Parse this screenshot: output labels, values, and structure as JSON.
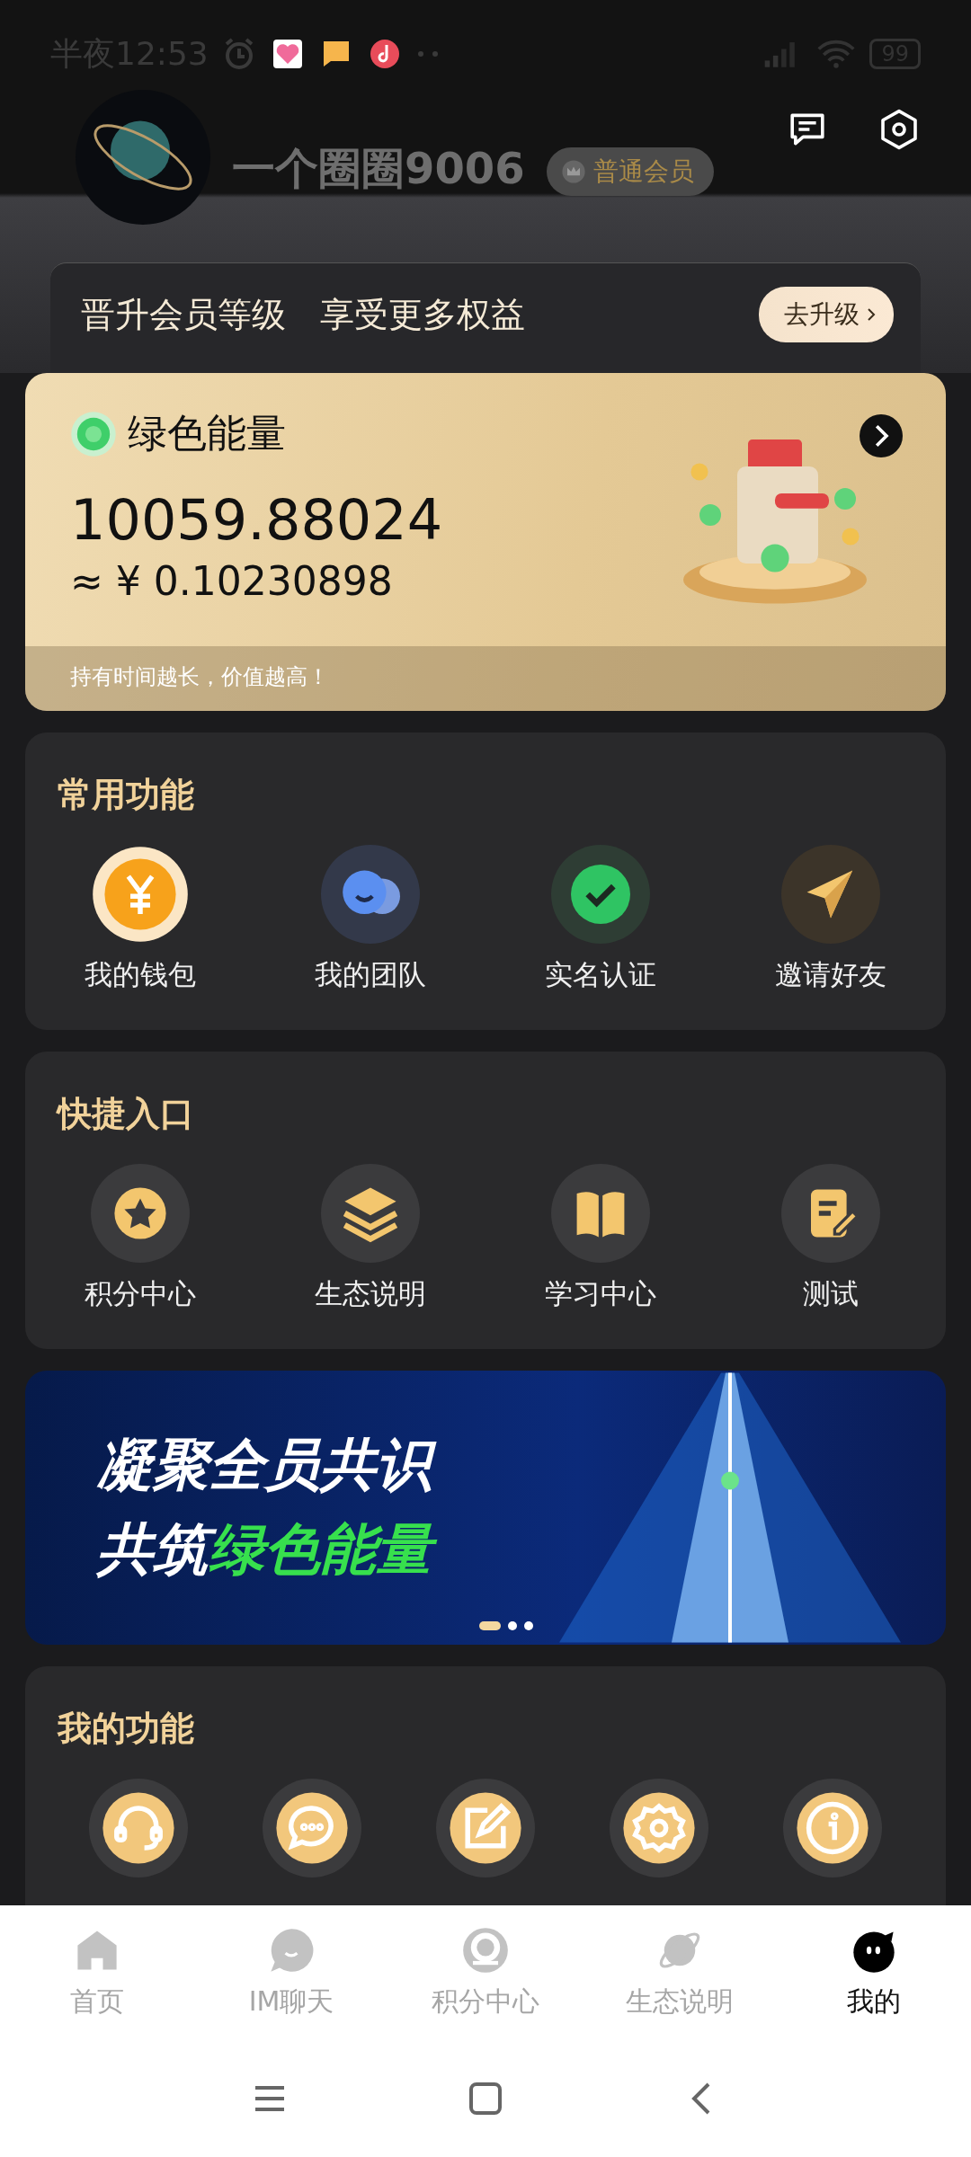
{
  "status_bar": {
    "time": "半夜12:53",
    "battery": "99"
  },
  "profile": {
    "name": "一个圈圈9006",
    "badge": "普通会员"
  },
  "upgrade": {
    "text_1": "晋升会员等级",
    "text_2": "享受更多权益",
    "button": "去升级"
  },
  "energy": {
    "title": "绿色能量",
    "amount": "10059.88024",
    "value": "≈ ¥ 0.10230898",
    "note": "持有时间越长，价值越高！"
  },
  "common": {
    "title": "常用功能",
    "items": [
      {
        "label": "我的钱包",
        "kind": "wallet"
      },
      {
        "label": "我的团队",
        "kind": "team"
      },
      {
        "label": "实名认证",
        "kind": "verify"
      },
      {
        "label": "邀请好友",
        "kind": "invite"
      }
    ]
  },
  "quick": {
    "title": "快捷入口",
    "items": [
      {
        "label": "积分中心",
        "kind": "star"
      },
      {
        "label": "生态说明",
        "kind": "layers"
      },
      {
        "label": "学习中心",
        "kind": "book"
      },
      {
        "label": "测试",
        "kind": "note"
      }
    ]
  },
  "banner": {
    "line_1": "凝聚全员共识",
    "line_2": "共筑",
    "line_2_highlight": "绿色能量",
    "dots": [
      {
        "selected": true
      },
      {
        "selected": false
      },
      {
        "selected": false
      }
    ]
  },
  "my_functions": {
    "title": "我的功能",
    "items": [
      {
        "kind": "headset"
      },
      {
        "kind": "chat"
      },
      {
        "kind": "edit"
      },
      {
        "kind": "gear"
      },
      {
        "kind": "info"
      }
    ]
  },
  "tabs": [
    {
      "label": "首页",
      "kind": "home",
      "selected": false
    },
    {
      "label": "IM聊天",
      "kind": "chat",
      "selected": false
    },
    {
      "label": "积分中心",
      "kind": "points",
      "selected": false
    },
    {
      "label": "生态说明",
      "kind": "planet",
      "selected": false
    },
    {
      "label": "我的",
      "kind": "me",
      "selected": true
    }
  ]
}
